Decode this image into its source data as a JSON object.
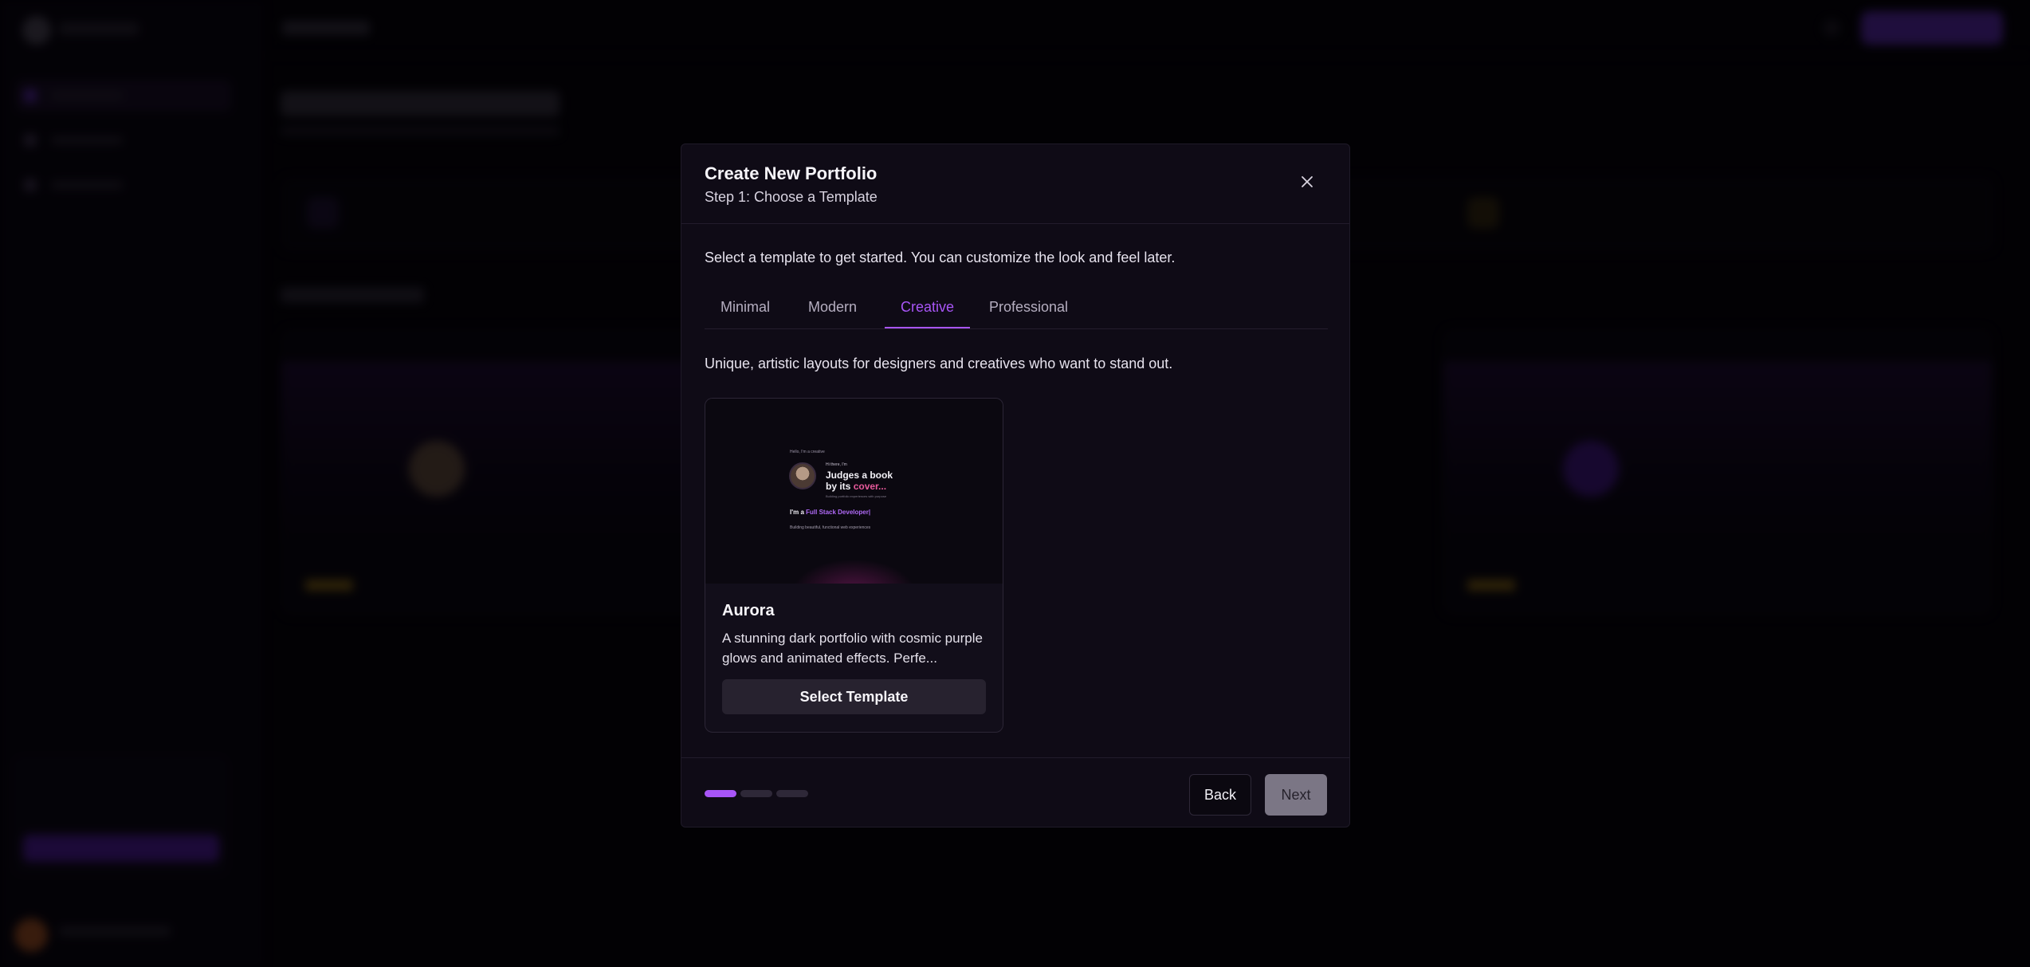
{
  "modal": {
    "title": "Create New Portfolio",
    "step": "Step 1: Choose a Template",
    "intro": "Select a template to get started. You can customize the look and feel later.",
    "tabs": [
      {
        "label": "Minimal",
        "active": false
      },
      {
        "label": "Modern",
        "active": false
      },
      {
        "label": "Creative",
        "active": true
      },
      {
        "label": "Professional",
        "active": false
      }
    ],
    "tab_description": "Unique, artistic layouts for designers and creatives who want to stand out.",
    "template": {
      "name": "Aurora",
      "description": "A stunning dark portfolio with cosmic purple glows and animated effects. Perfe...",
      "select_label": "Select Template",
      "preview": {
        "top_text": "Hello, I'm a creative",
        "hello": "Hi there, I'm",
        "headline_1": "Judges a book",
        "headline_2_prefix": "by its ",
        "headline_2_accent": "cover...",
        "small_text": "Building portfolio experiences with purpose",
        "im_prefix": "I'm a ",
        "im_accent": "Full Stack Developer|",
        "line": "Building beautiful, functional web experiences"
      }
    },
    "progress": {
      "total_steps": 3,
      "current_step": 1
    },
    "back_label": "Back",
    "next_label": "Next"
  },
  "colors": {
    "accent": "#a855f7",
    "background": "#05030a",
    "modal_bg": "#0f0b16",
    "cta": "#7c3aed"
  },
  "icons": {
    "close": "close-icon"
  }
}
